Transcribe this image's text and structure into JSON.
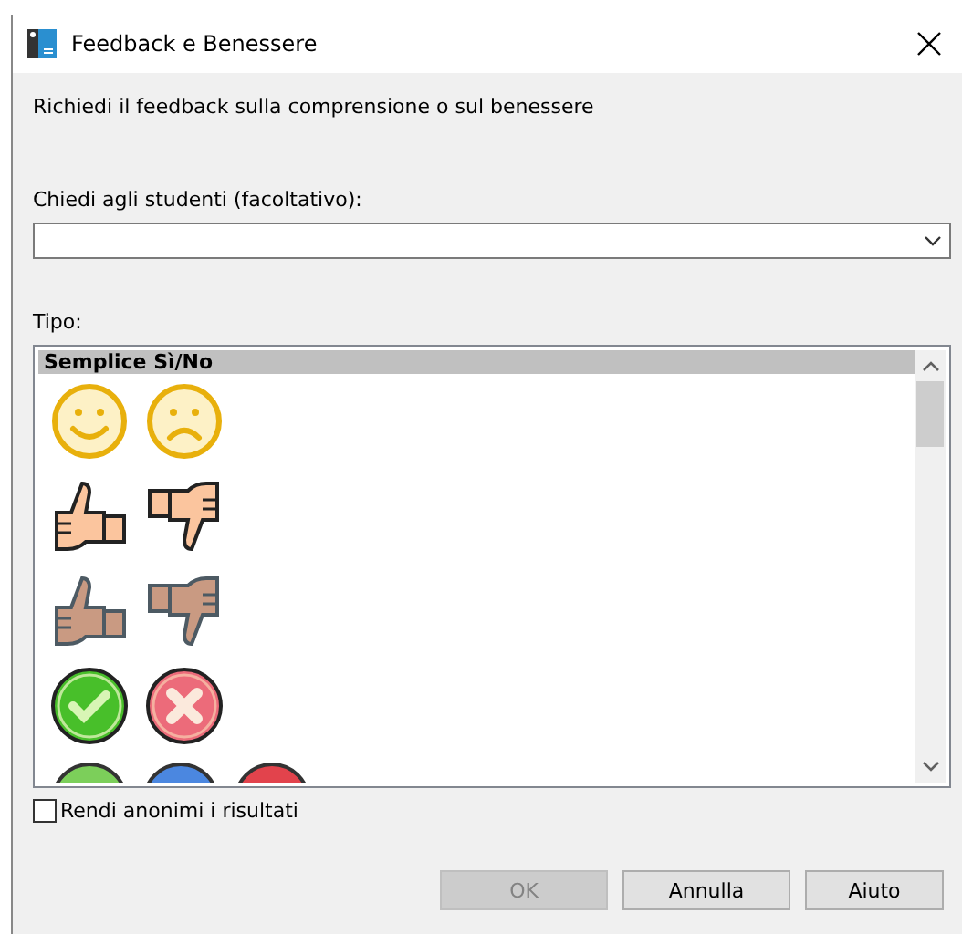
{
  "window": {
    "title": "Feedback e Benessere"
  },
  "instruction": "Richiedi il feedback sulla comprensione o sul benessere",
  "ask_field": {
    "label": "Chiedi agli studenti (facoltativo):"
  },
  "type_list": {
    "label": "Tipo:",
    "group_header": "Semplice Sì/No"
  },
  "anonymize": {
    "label": "Rendi anonimi i risultati",
    "checked": false
  },
  "buttons": [
    {
      "label": "OK",
      "disabled": true
    },
    {
      "label": "Annulla",
      "disabled": false
    },
    {
      "label": "Aiuto",
      "disabled": false
    }
  ]
}
